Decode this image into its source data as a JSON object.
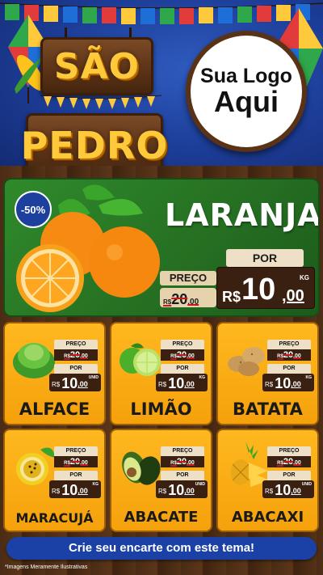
{
  "header": {
    "sign_line1": "SÃO",
    "sign_line2": "PEDRO",
    "logo_line1": "Sua Logo",
    "logo_line2": "Aqui"
  },
  "hero": {
    "discount_badge": "-50%",
    "product": "LARANJA",
    "preco_label": "PREÇO",
    "old_currency": "R$",
    "old_price_int": "20",
    "old_price_dec": ",00",
    "por_label": "POR",
    "new_currency": "R$",
    "new_price_int": "10",
    "new_price_dec": ",00",
    "unit": "KG"
  },
  "cards": [
    {
      "name": "ALFACE",
      "preco_label": "PREÇO",
      "old_currency": "R$",
      "old_int": "20",
      "old_dec": ",00",
      "por_label": "POR",
      "new_currency": "R$",
      "new_int": "10",
      "new_dec": ",00",
      "unit": "UNID",
      "fruit_icon": "lettuce-icon"
    },
    {
      "name": "LIMÃO",
      "preco_label": "PREÇO",
      "old_currency": "R$",
      "old_int": "20",
      "old_dec": ",00",
      "por_label": "POR",
      "new_currency": "R$",
      "new_int": "10",
      "new_dec": ",00",
      "unit": "KG",
      "fruit_icon": "lime-icon"
    },
    {
      "name": "BATATA",
      "preco_label": "PREÇO",
      "old_currency": "R$",
      "old_int": "20",
      "old_dec": ",00",
      "por_label": "POR",
      "new_currency": "R$",
      "new_int": "10",
      "new_dec": ",00",
      "unit": "KG",
      "fruit_icon": "potato-icon"
    },
    {
      "name": "MARACUJÁ",
      "preco_label": "PREÇO",
      "old_currency": "R$",
      "old_int": "20",
      "old_dec": ",00",
      "por_label": "POR",
      "new_currency": "R$",
      "new_int": "10",
      "new_dec": ",00",
      "unit": "KG",
      "fruit_icon": "passion-fruit-icon"
    },
    {
      "name": "ABACATE",
      "preco_label": "PREÇO",
      "old_currency": "R$",
      "old_int": "20",
      "old_dec": ",00",
      "por_label": "POR",
      "new_currency": "R$",
      "new_int": "10",
      "new_dec": ",00",
      "unit": "UNID",
      "fruit_icon": "avocado-icon"
    },
    {
      "name": "ABACAXI",
      "preco_label": "PREÇO",
      "old_currency": "R$",
      "old_int": "20",
      "old_dec": ",00",
      "por_label": "POR",
      "new_currency": "R$",
      "new_int": "10",
      "new_dec": ",00",
      "unit": "UNID",
      "fruit_icon": "pineapple-icon"
    }
  ],
  "footer": {
    "cta": "Crie seu encarte com este tema!",
    "disclaimer": "*Imagens Meramente Ilustrativas"
  },
  "colors": {
    "header_blue": "#1c3c96",
    "hero_green": "#2f8a2b",
    "card_orange": "#ffb81f",
    "wood_brown": "#5b361a",
    "sign_yellow": "#ffc93c",
    "cta_blue": "#1c41a6"
  }
}
